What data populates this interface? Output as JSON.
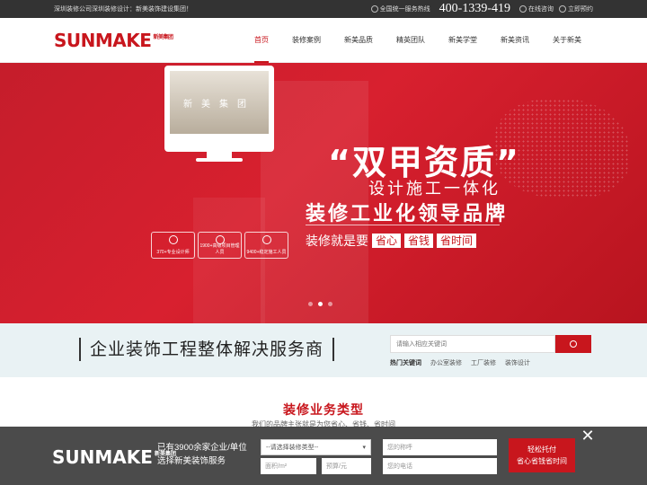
{
  "topbar": {
    "left_text": "深圳装修公司深圳装修设计：新美装饰建设集团！",
    "hotline_label": "全国统一服务热线",
    "phone": "400-1339-419",
    "online_consult": "在线咨询",
    "book_now": "立即预约"
  },
  "header": {
    "logo_text": "SUNMAKE",
    "logo_sub": "新美集团",
    "nav": [
      {
        "label": "首页",
        "active": true
      },
      {
        "label": "装修案例"
      },
      {
        "label": "新美品质"
      },
      {
        "label": "精英团队"
      },
      {
        "label": "新美学堂"
      },
      {
        "label": "新美资讯"
      },
      {
        "label": "关于新美"
      }
    ]
  },
  "banner": {
    "screen_text": "新美集团",
    "title": "“双甲资质”",
    "subtitle": "设计施工一体化",
    "headline": "装修工业化领导品牌",
    "tagline": "装修就是要",
    "tags": [
      "省心",
      "省钱",
      "省时间"
    ],
    "stats": [
      "370+专业设计师",
      "1900+高级项目管理人员",
      "9400+稳定施工人员"
    ],
    "slides": 3,
    "active_slide": 2
  },
  "search_strip": {
    "slogan": "企业装饰工程整体解决服务商",
    "search_placeholder": "请输入相应关键词",
    "hot_keywords_label": "热门关键词",
    "keywords": [
      "办公室装修",
      "工厂装修",
      "装饰设计"
    ]
  },
  "section": {
    "title": "装修业务类型",
    "subtitle": "我们的品牌主张就是为您省心、省钱、省时间"
  },
  "bottom_bar": {
    "logo_text": "SUNMAKE",
    "logo_sub": "新美集团",
    "line1": "已有3900余家企业/单位",
    "line2": "选择新美装饰服务",
    "select_placeholder": "--请选择装修类型--",
    "name_placeholder": "您的称呼",
    "area_placeholder": "面积/m²",
    "budget_placeholder": "预算/元",
    "phone_placeholder": "您的电话",
    "cta_line1": "轻松托付",
    "cta_line2": "省心省钱省时间",
    "close": "✕"
  },
  "colors": {
    "brand_red": "#c8161d",
    "topbar": "#333333",
    "strip": "#e9f2f4"
  }
}
